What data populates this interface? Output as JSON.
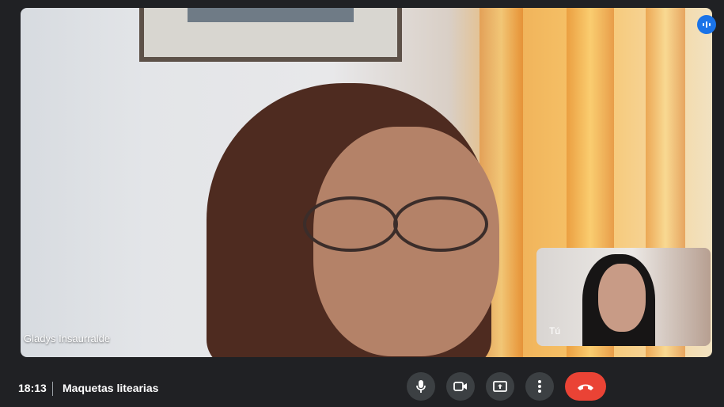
{
  "meeting": {
    "time": "18:13",
    "title": "Maquetas litearias"
  },
  "participants": {
    "main": {
      "name": "Gladys Insaurralde"
    },
    "self": {
      "label": "Tú"
    }
  },
  "controls": {
    "mic_icon": "mic-icon",
    "camera_icon": "camera-icon",
    "present_icon": "present-screen-icon",
    "more_icon": "more-vertical-icon",
    "end_icon": "phone-hangup-icon"
  },
  "colors": {
    "background": "#202124",
    "control_bg": "#3c4043",
    "end_call": "#ea4335",
    "speaking_badge": "#1a73e8"
  }
}
